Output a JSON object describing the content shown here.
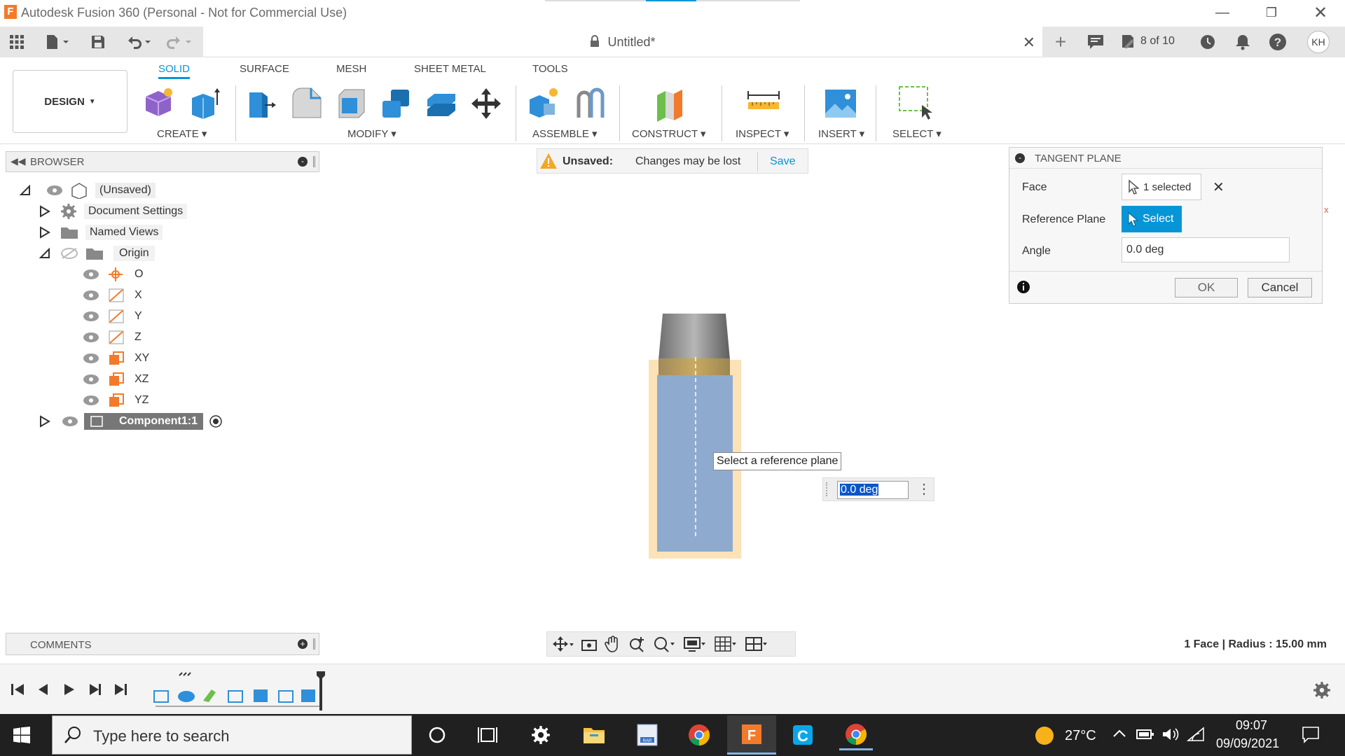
{
  "app": {
    "title": "Autodesk Fusion 360 (Personal - Not for Commercial Use)",
    "doc_title": "Untitled*",
    "job_status": "8 of 10",
    "user_initials": "KH",
    "accent": "#0696d7"
  },
  "ribbon": {
    "workspace": "DESIGN",
    "tabs": [
      "SOLID",
      "SURFACE",
      "MESH",
      "SHEET METAL",
      "TOOLS"
    ],
    "active_tab": "SOLID",
    "groups": [
      "CREATE",
      "MODIFY",
      "ASSEMBLE",
      "CONSTRUCT",
      "INSPECT",
      "INSERT",
      "SELECT"
    ]
  },
  "browser": {
    "title": "BROWSER",
    "root": "(Unsaved)",
    "items": {
      "doc_settings": "Document Settings",
      "named_views": "Named Views",
      "origin": "Origin",
      "o": "O",
      "x": "X",
      "y": "Y",
      "z": "Z",
      "xy": "XY",
      "xz": "XZ",
      "yz": "YZ",
      "component": "Component1:1"
    }
  },
  "banner": {
    "label": "Unsaved:",
    "message": "Changes may be lost",
    "save": "Save"
  },
  "panel": {
    "title": "TANGENT PLANE",
    "face_label": "Face",
    "face_value": "1 selected",
    "refplane_label": "Reference Plane",
    "refplane_btn": "Select",
    "angle_label": "Angle",
    "angle_value": "0.0 deg",
    "ok": "OK",
    "cancel": "Cancel"
  },
  "viewport": {
    "tooltip": "Select a reference plane",
    "angle_input": "0.0 deg",
    "status": "1 Face | Radius : 15.00 mm"
  },
  "comments": {
    "title": "COMMENTS"
  },
  "taskbar": {
    "search_placeholder": "Type here to search",
    "weather": "27°C",
    "time": "09:07",
    "date": "09/09/2021"
  }
}
